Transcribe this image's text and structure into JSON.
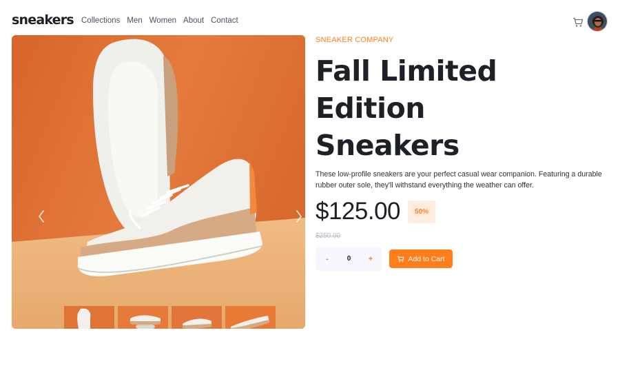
{
  "header": {
    "logo": "sneakers",
    "nav": [
      "Collections",
      "Men",
      "Women",
      "About",
      "Contact"
    ],
    "cart_icon": "cart-icon",
    "avatar_icon": "user-avatar"
  },
  "gallery": {
    "prev_icon": "chevron-left-icon",
    "next_icon": "chevron-right-icon",
    "thumbnail_count": 4
  },
  "product": {
    "brand": "SNEAKER COMPANY",
    "title_line1": "Fall Limited Edition",
    "title_line2": "Sneakers",
    "description": "These low-profile sneakers are your perfect casual wear companion. Featuring a durable rubber outer sole, they'll withstand everything the weather can offer.",
    "price": "$125.00",
    "discount": "50%",
    "original_price": "$250.00",
    "quantity": "0",
    "decrement_label": "-",
    "increment_label": "+",
    "add_to_cart_label": "Add to Cart"
  },
  "colors": {
    "accent": "#ff7e1b",
    "accent_pale": "#ffede0",
    "text_dark": "#1d2026",
    "text_muted": "#b6bcc8",
    "photo_orange": "#e2773a",
    "photo_sand": "#e8b47c"
  }
}
